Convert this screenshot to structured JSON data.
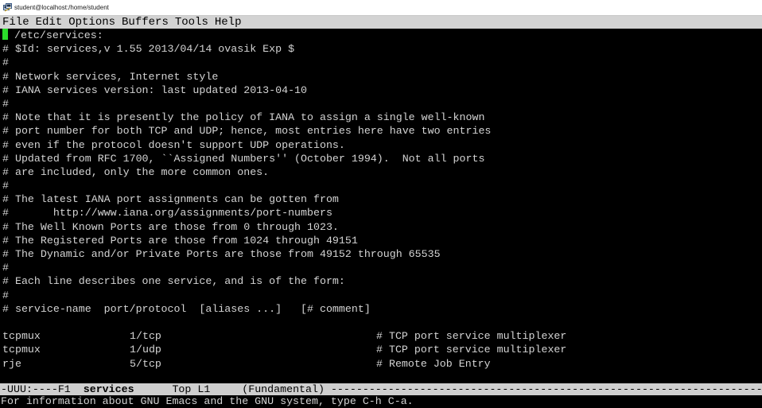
{
  "window": {
    "title": "student@localhost:/home/student",
    "icon": "putty-terminal-icon"
  },
  "menubar": {
    "items": [
      "File",
      "Edit",
      "Options",
      "Buffers",
      "Tools",
      "Help"
    ]
  },
  "buffer": {
    "lines": [
      " /etc/services:",
      "# $Id: services,v 1.55 2013/04/14 ovasik Exp $",
      "#",
      "# Network services, Internet style",
      "# IANA services version: last updated 2013-04-10",
      "#",
      "# Note that it is presently the policy of IANA to assign a single well-known",
      "# port number for both TCP and UDP; hence, most entries here have two entries",
      "# even if the protocol doesn't support UDP operations.",
      "# Updated from RFC 1700, ``Assigned Numbers'' (October 1994).  Not all ports",
      "# are included, only the more common ones.",
      "#",
      "# The latest IANA port assignments can be gotten from",
      "#       http://www.iana.org/assignments/port-numbers",
      "# The Well Known Ports are those from 0 through 1023.",
      "# The Registered Ports are those from 1024 through 49151",
      "# The Dynamic and/or Private Ports are those from 49152 through 65535",
      "#",
      "# Each line describes one service, and is of the form:",
      "#",
      "# service-name  port/protocol  [aliases ...]   [# comment]",
      ""
    ],
    "entries": [
      {
        "name": "tcpmux",
        "port": "1/tcp",
        "comment": "# TCP port service multiplexer"
      },
      {
        "name": "tcpmux",
        "port": "1/udp",
        "comment": "# TCP port service multiplexer"
      },
      {
        "name": "rje",
        "port": "5/tcp",
        "comment": "# Remote Job Entry"
      }
    ]
  },
  "modeline": {
    "status": "-UUU:----F1  ",
    "buffer_name": "services",
    "position": "      Top L1     ",
    "mode": "(Fundamental) ",
    "dashes": "---------------------------------------------------------------------"
  },
  "echo_area": {
    "message": "For information about GNU Emacs and the GNU system, type C-h C-a."
  },
  "colors": {
    "cursor": "#2bdc2b",
    "modeline_bg": "#cfcfcf",
    "menubar_bg": "#d3d3d3",
    "text": "#d4d4d4"
  }
}
